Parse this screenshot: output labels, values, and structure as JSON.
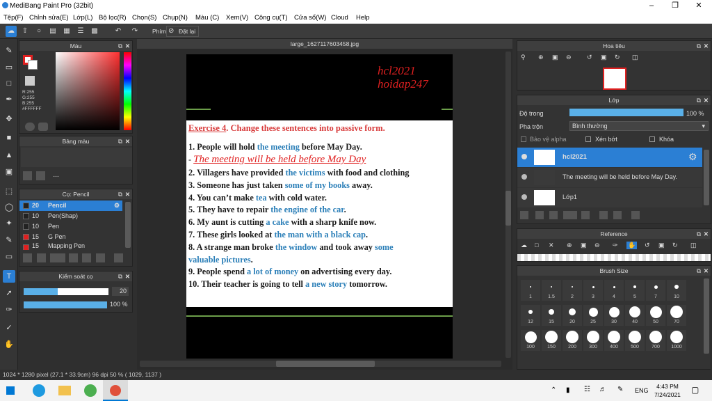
{
  "window": {
    "title": "MediBang Paint Pro (32bit)"
  },
  "menu": [
    "Tệp(F)",
    "Chỉnh sửa(E)",
    "Lớp(L)",
    "Bộ lọc(R)",
    "Chọn(S)",
    "Chụp(N)",
    "Màu (C)",
    "Xem(V)",
    "Công cụ(T)",
    "Cửa sổ(W)",
    "Cloud",
    "Help"
  ],
  "toolbar": {
    "keyboard_label": "Phím",
    "reset_label": "Đặt lại"
  },
  "color_panel": {
    "title": "Màu",
    "r": "R:255",
    "g": "G:255",
    "b": "B:255",
    "hex": "#FFFFFF"
  },
  "palette_panel": {
    "title": "Bảng màu",
    "dash": "---"
  },
  "brush_panel": {
    "title": "Cọ: Pencil",
    "items": [
      {
        "size": "20",
        "name": "Pencil",
        "color": "#222222"
      },
      {
        "size": "10",
        "name": "Pen(Shap)",
        "color": "#222222"
      },
      {
        "size": "10",
        "name": "Pen",
        "color": "#222222"
      },
      {
        "size": "15",
        "name": "G Pen",
        "color": "#e02020"
      },
      {
        "size": "15",
        "name": "Mapping Pen",
        "color": "#e02020"
      }
    ]
  },
  "brush_control": {
    "title": "Kiểm soát cọ",
    "size": "20",
    "opacity": "100 %"
  },
  "document": {
    "tab": "large_1627117603458.jpg",
    "watermark1": "hcl2021",
    "watermark2": "hoidap247",
    "heading_red": "Exercise 4",
    "heading_rest": ". Change these sentences into passive form.",
    "handwritten": "The meeting will be held before May Day"
  },
  "navigator": {
    "title": "Hoa tiêu"
  },
  "layers_panel": {
    "title": "Lớp",
    "opacity_label": "Độ trong",
    "opacity_value": "100 %",
    "blend_label": "Pha trộn",
    "blend_value": "Bình thường",
    "protect_alpha": "Bảo vệ alpha",
    "clip": "Xén bớt",
    "lock": "Khóa",
    "layers": [
      {
        "name": "hcl2021"
      },
      {
        "name": "The meeting will be held before May Day."
      },
      {
        "name": "Lớp1"
      }
    ]
  },
  "reference_panel": {
    "title": "Reference"
  },
  "brush_size_panel": {
    "title": "Brush Size",
    "sizes": [
      "1",
      "1.5",
      "2",
      "3",
      "4",
      "5",
      "7",
      "10",
      "12",
      "15",
      "20",
      "25",
      "30",
      "40",
      "50",
      "70",
      "100",
      "150",
      "200",
      "300",
      "400",
      "500",
      "700",
      "1000"
    ]
  },
  "status": {
    "text": "1024 * 1280 pixel  (27.1 * 33.9cm)  96 dpi  50 %  ( 1029, 1137 )"
  },
  "taskbar": {
    "time": "4:43 PM",
    "date": "7/24/2021",
    "lang": "ENG"
  }
}
